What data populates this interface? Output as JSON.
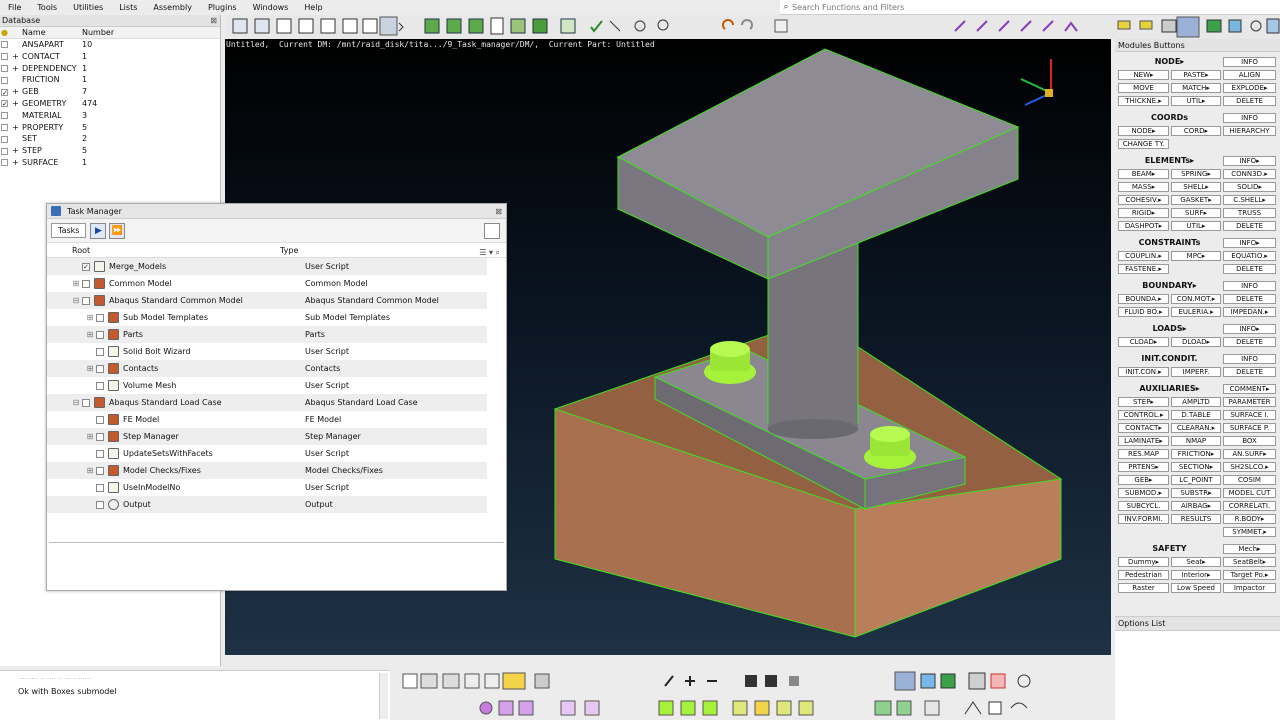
{
  "menu": [
    "File",
    "Tools",
    "Utilities",
    "Lists",
    "Assembly",
    "Plugins",
    "Windows",
    "Help"
  ],
  "search": {
    "placeholder": "Search Functions and Filters"
  },
  "database": {
    "title": "Database",
    "columns": [
      "Name",
      "Number"
    ],
    "rows": [
      {
        "checked": false,
        "expand": "",
        "name": "ANSAPART",
        "number": "10"
      },
      {
        "checked": false,
        "expand": "+",
        "name": "CONTACT",
        "number": "1"
      },
      {
        "checked": false,
        "expand": "+",
        "name": "DEPENDENCY",
        "number": "1"
      },
      {
        "checked": false,
        "expand": "",
        "name": "FRICTION",
        "number": "1"
      },
      {
        "checked": true,
        "expand": "+",
        "name": "GEB",
        "number": "7"
      },
      {
        "checked": true,
        "expand": "+",
        "name": "GEOMETRY",
        "number": "474"
      },
      {
        "checked": false,
        "expand": "",
        "name": "MATERIAL",
        "number": "3"
      },
      {
        "checked": false,
        "expand": "+",
        "name": "PROPERTY",
        "number": "5"
      },
      {
        "checked": false,
        "expand": "",
        "name": "SET",
        "number": "2"
      },
      {
        "checked": false,
        "expand": "+",
        "name": "STEP",
        "number": "5"
      },
      {
        "checked": false,
        "expand": "+",
        "name": "SURFACE",
        "number": "1"
      }
    ]
  },
  "viewport": {
    "status": "Untitled,  Current DM: /mnt/raid_disk/tita.../9_Task_manager/DM/,  Current Part: Untitled"
  },
  "task_manager": {
    "title": "Task Manager",
    "tasks_label": "Tasks",
    "columns": [
      "Root",
      "Type"
    ],
    "rows": [
      {
        "level": 1,
        "expand": "",
        "checked": true,
        "icon": "script",
        "name": "Merge_Models",
        "type": "User Script"
      },
      {
        "level": 1,
        "expand": "+",
        "checked": false,
        "icon": "model",
        "name": "Common Model",
        "type": "Common Model"
      },
      {
        "level": 1,
        "expand": "-",
        "checked": false,
        "icon": "model",
        "name": "Abaqus Standard Common Model",
        "type": "Abaqus Standard Common Model"
      },
      {
        "level": 2,
        "expand": "+",
        "checked": false,
        "icon": "model",
        "name": "Sub Model Templates",
        "type": "Sub Model Templates"
      },
      {
        "level": 2,
        "expand": "+",
        "checked": false,
        "icon": "model",
        "name": "Parts",
        "type": "Parts"
      },
      {
        "level": 2,
        "expand": "",
        "checked": false,
        "icon": "script",
        "name": "Solid Bolt Wizard",
        "type": "User Script"
      },
      {
        "level": 2,
        "expand": "+",
        "checked": false,
        "icon": "model",
        "name": "Contacts",
        "type": "Contacts"
      },
      {
        "level": 2,
        "expand": "",
        "checked": false,
        "icon": "script",
        "name": "Volume Mesh",
        "type": "User Script"
      },
      {
        "level": 1,
        "expand": "-",
        "checked": false,
        "icon": "model",
        "name": "Abaqus Standard Load Case",
        "type": "Abaqus Standard Load Case"
      },
      {
        "level": 2,
        "expand": "",
        "checked": false,
        "icon": "model",
        "name": "FE Model",
        "type": "FE Model"
      },
      {
        "level": 2,
        "expand": "+",
        "checked": false,
        "icon": "model",
        "name": "Step Manager",
        "type": "Step Manager"
      },
      {
        "level": 2,
        "expand": "",
        "checked": false,
        "icon": "script",
        "name": "UpdateSetsWithFacets",
        "type": "User Script"
      },
      {
        "level": 2,
        "expand": "+",
        "checked": false,
        "icon": "model",
        "name": "Model Checks/Fixes",
        "type": "Model Checks/Fixes"
      },
      {
        "level": 2,
        "expand": "",
        "checked": false,
        "icon": "script",
        "name": "UseInModelNo",
        "type": "User Script"
      },
      {
        "level": 2,
        "expand": "",
        "checked": false,
        "icon": "out",
        "name": "Output",
        "type": "Output"
      }
    ]
  },
  "modules": {
    "title": "Modules Buttons",
    "sections": [
      {
        "title": "NODE▸",
        "info": "INFO",
        "rows": [
          [
            "NEW▸",
            "PASTE▸",
            "ALIGN"
          ],
          [
            "MOVE",
            "MATCH▸",
            "EXPLODE▸"
          ],
          [
            "THICKNE.▸",
            "UTIL▸",
            "DELETE"
          ]
        ]
      },
      {
        "title": "COORDs",
        "info": "INFO",
        "rows": [
          [
            "NODE▸",
            "CORD▸",
            "HIERARCHY"
          ],
          [
            "CHANGE TY.",
            "",
            ""
          ]
        ]
      },
      {
        "title": "ELEMENTs▸",
        "info": "INFO▸",
        "rows": [
          [
            "BEAM▸",
            "SPRING▸",
            "CONN3D.▸"
          ],
          [
            "MASS▸",
            "SHELL▸",
            "SOLID▸"
          ],
          [
            "COHESIV.▸",
            "GASKET▸",
            "C.SHELL▸"
          ],
          [
            "RIGID▸",
            "SURF▸",
            "TRUSS"
          ],
          [
            "DASHPOT▸",
            "UTIL▸",
            "DELETE"
          ]
        ]
      },
      {
        "title": "CONSTRAINTs",
        "info": "INFO▸",
        "rows": [
          [
            "COUPLIN.▸",
            "MPC▸",
            "EQUATIO.▸"
          ],
          [
            "FASTENE.▸",
            "",
            "DELETE"
          ]
        ]
      },
      {
        "title": "BOUNDARY▸",
        "info": "INFO",
        "rows": [
          [
            "BOUNDA.▸",
            "CON.MOT.▸",
            "DELETE"
          ],
          [
            "FLUID BO.▸",
            "EULERIA.▸",
            "IMPEDAN.▸"
          ]
        ]
      },
      {
        "title": "LOADS▸",
        "info": "INFO▸",
        "rows": [
          [
            "CLOAD▸",
            "DLOAD▸",
            "DELETE"
          ]
        ]
      },
      {
        "title": "INIT.CONDIT.",
        "info": "INFO",
        "rows": [
          [
            "INIT.CON.▸",
            "IMPERF.",
            "DELETE"
          ]
        ]
      },
      {
        "title": "AUXILIARIES▸",
        "info": "COMMENT▸",
        "rows": [
          [
            "STEP▸",
            "AMPLTD",
            "PARAMETER"
          ],
          [
            "CONTROL.▸",
            "D.TABLE",
            "SURFACE I."
          ],
          [
            "CONTACT▸",
            "CLEARAN.▸",
            "SURFACE P."
          ],
          [
            "LAMINATE▸",
            "NMAP",
            "BOX"
          ],
          [
            "RES.MAP",
            "FRICTION▸",
            "AN.SURF▸"
          ],
          [
            "PRTENS▸",
            "SECTION▸",
            "SH2SLCO.▸"
          ],
          [
            "GEB▸",
            "LC_POINT",
            "COSIM"
          ],
          [
            "SUBMOD.▸",
            "SUBSTR▸",
            "MODEL CUT"
          ],
          [
            "SUBCYCL.",
            "AIRBAG▸",
            "CORRELATI."
          ],
          [
            "INV.FORMI.",
            "RESULTS",
            "R.BODY▸"
          ],
          [
            "",
            "",
            "SYMMET.▸"
          ]
        ]
      },
      {
        "title": "SAFETY",
        "info": "Mech▸",
        "rows": [
          [
            "Dummy▸",
            "Seat▸",
            "SeatBelt▸"
          ],
          [
            "Pedestrian",
            "Interior▸",
            "Target Po.▸"
          ],
          [
            "Raster",
            "Low Speed",
            "Impactor"
          ]
        ]
      }
    ]
  },
  "options": {
    "title": "Options List"
  },
  "messages": {
    "text": "Ok with Boxes submodel",
    "partial_line": "......... .. .... .. ... ........"
  },
  "colors": {
    "viewport_top": "#000000",
    "viewport_bottom": "#1e3145",
    "face_grey": "#8a8790",
    "base_brown": "#a9704f",
    "bolt_green": "#a6f23a",
    "edge_green": "#3fe020"
  }
}
